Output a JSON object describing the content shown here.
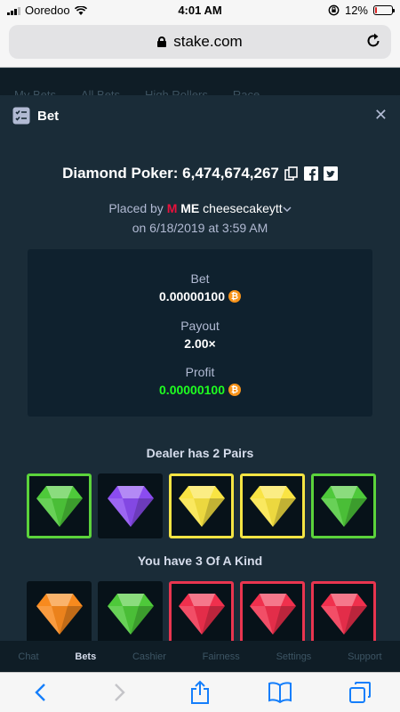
{
  "status_bar": {
    "carrier": "Ooredoo",
    "time": "4:01 AM",
    "battery_percent": "12%",
    "battery_level": 0.12,
    "battery_color": "#dd2222"
  },
  "browser": {
    "url": "stake.com"
  },
  "background_tabs": [
    "My Bets",
    "All Bets",
    "High Rollers",
    "Race"
  ],
  "modal": {
    "title": "Bet",
    "game_name": "Diamond Poker: 6,474,674,267",
    "placed_by_prefix": "Placed by",
    "vip_letter": "M",
    "rank": "ME",
    "username": "cheesecakeytt",
    "date": "on 6/18/2019 at 3:59 AM",
    "stats": {
      "bet_label": "Bet",
      "bet_value": "0.00000100",
      "payout_label": "Payout",
      "payout_value": "2.00×",
      "profit_label": "Profit",
      "profit_value": "0.00000100",
      "currency_icon": "bitcoin-icon"
    },
    "dealer": {
      "label": "Dealer has 2 Pairs",
      "gems": [
        {
          "gem": "green",
          "highlight": "green"
        },
        {
          "gem": "purple",
          "highlight": "none"
        },
        {
          "gem": "yellow",
          "highlight": "yellow"
        },
        {
          "gem": "yellow",
          "highlight": "yellow"
        },
        {
          "gem": "green",
          "highlight": "green"
        }
      ]
    },
    "player": {
      "label": "You have 3 Of A Kind",
      "gems": [
        {
          "gem": "orange",
          "highlight": "none"
        },
        {
          "gem": "green",
          "highlight": "none"
        },
        {
          "gem": "red",
          "highlight": "red"
        },
        {
          "gem": "red",
          "highlight": "red"
        },
        {
          "gem": "red",
          "highlight": "red"
        }
      ]
    }
  },
  "bottom_nav": [
    {
      "label": "Chat",
      "active": false
    },
    {
      "label": "Bets",
      "active": true
    },
    {
      "label": "Cashier",
      "active": false
    },
    {
      "label": "Fairness",
      "active": false
    },
    {
      "label": "Settings",
      "active": false
    },
    {
      "label": "Support",
      "active": false
    }
  ],
  "colors": {
    "background": "#1a2c38",
    "panel": "#0f212e",
    "profit_green": "#1fff20",
    "bitcoin": "#f7931a",
    "gem_green": "#4ec93a",
    "gem_purple": "#8b4cf0",
    "gem_yellow": "#f9e443",
    "gem_orange": "#f88a1e",
    "gem_red": "#f0304d"
  }
}
